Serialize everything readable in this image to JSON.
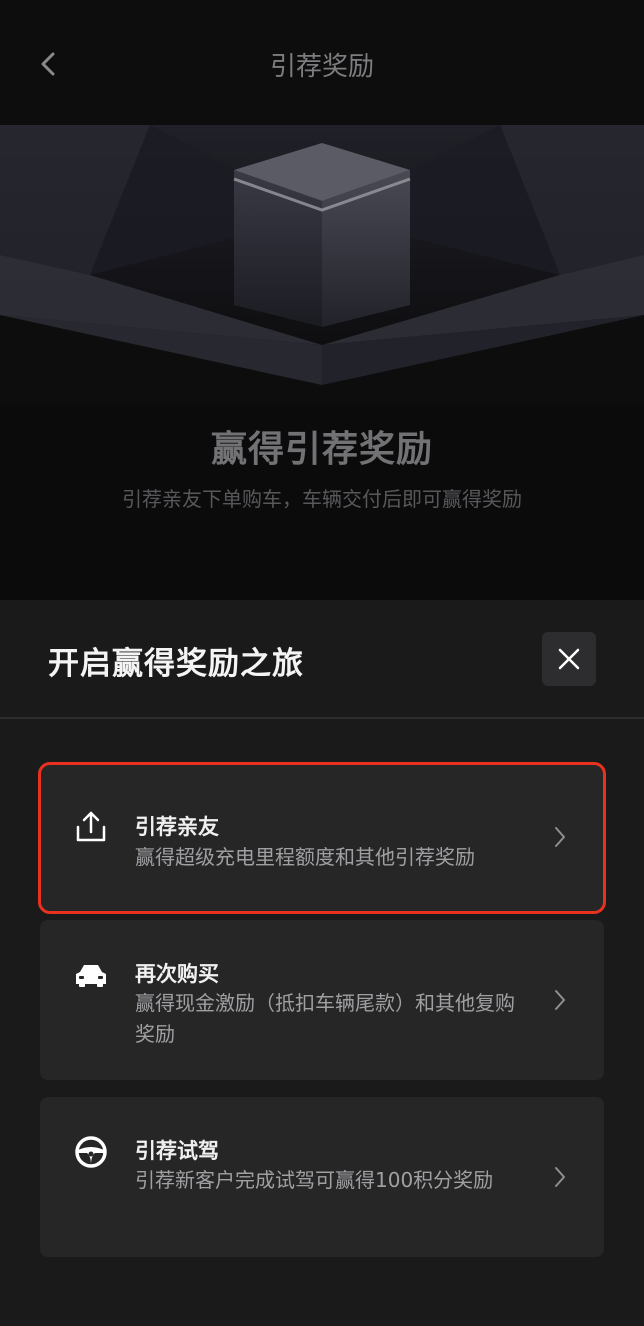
{
  "header": {
    "title": "引荐奖励",
    "back_icon": "chevron-left-icon"
  },
  "hero": {
    "title": "赢得引荐奖励",
    "subtitle": "引荐亲友下单购车，车辆交付后即可赢得奖励"
  },
  "sheet": {
    "title": "开启赢得奖励之旅",
    "close_icon": "close-icon",
    "options": [
      {
        "icon": "share-upload-icon",
        "title": "引荐亲友",
        "description": "赢得超级充电里程额度和其他引荐奖励",
        "highlighted": true
      },
      {
        "icon": "car-icon",
        "title": "再次购买",
        "description": "赢得现金激励（抵扣车辆尾款）和其他复购奖励"
      },
      {
        "icon": "steering-wheel-icon",
        "title": "引荐试驾",
        "description": "引荐新客户完成试驾可赢得100积分奖励"
      }
    ]
  },
  "colors": {
    "background": "#0b0b0c",
    "sheet": "#1a1a1b",
    "card": "#262627",
    "highlight": "#e8321f"
  }
}
